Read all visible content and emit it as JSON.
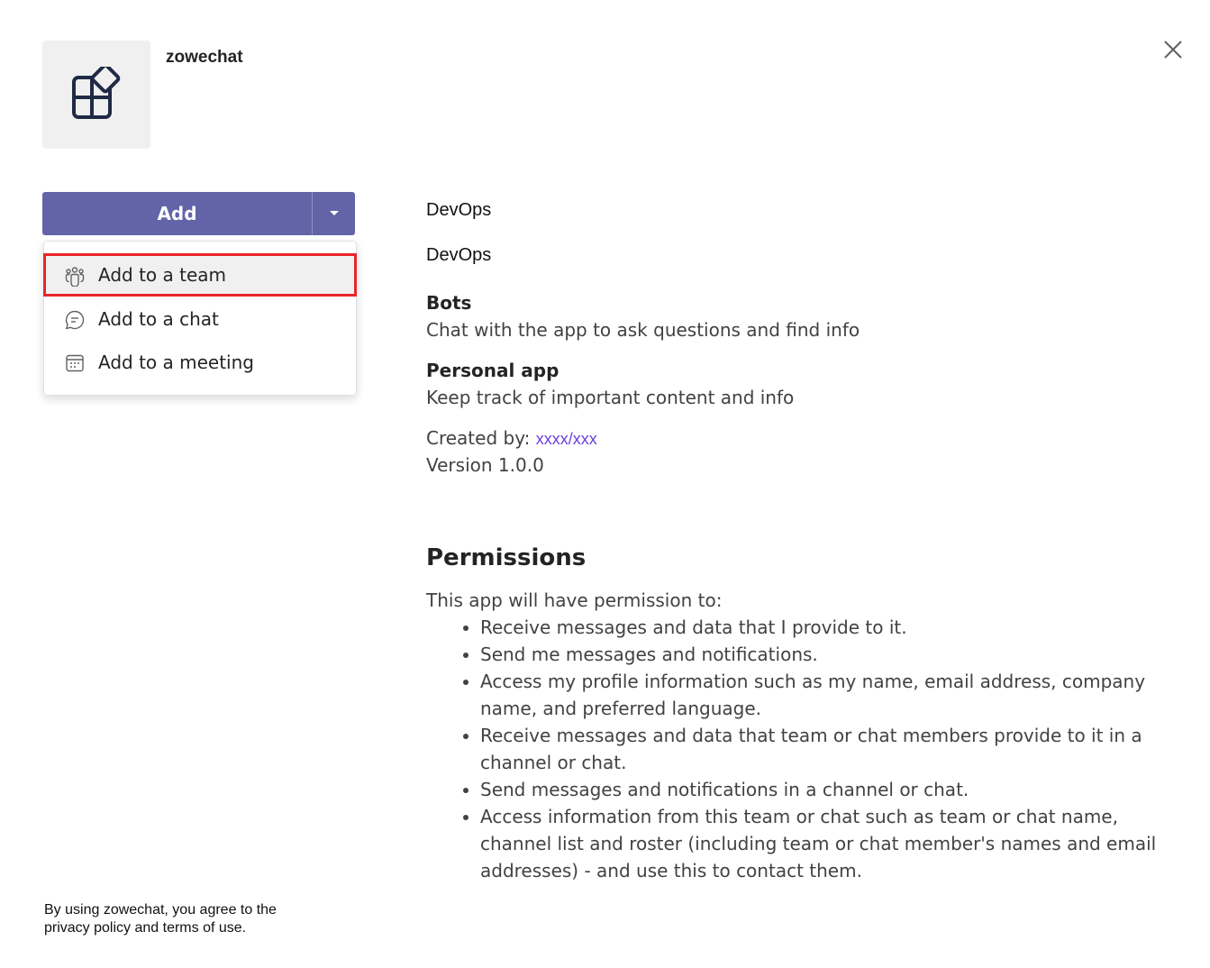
{
  "app": {
    "name": "zowechat",
    "icon": "apps-add-icon"
  },
  "add_button": {
    "label": "Add",
    "caret_icon": "caret-down-icon"
  },
  "menu": {
    "items": [
      {
        "label": "Add to a team",
        "icon": "team-icon"
      },
      {
        "label": "Add to a chat",
        "icon": "chat-icon"
      },
      {
        "label": "Add to a meeting",
        "icon": "calendar-icon"
      }
    ]
  },
  "details": {
    "developer": "DevOps",
    "category": "DevOps",
    "bots_title": "Bots",
    "bots_desc": "Chat with the app to ask questions and find info",
    "personal_title": "Personal app",
    "personal_desc": "Keep track of important content and info",
    "created_by_label": "Created by:",
    "created_by_link": "xxxx/xxx",
    "version": "Version 1.0.0"
  },
  "permissions": {
    "title": "Permissions",
    "intro": "This app will have permission to:",
    "items": [
      "Receive messages and data that I provide to it.",
      "Send me messages and notifications.",
      "Access my profile information such as my name, email address, company name, and preferred language.",
      "Receive messages and data that team or chat members provide to it in a channel or chat.",
      "Send messages and notifications in a channel or chat.",
      "Access information from this team or chat such as team or chat name, channel list and roster (including team or chat member's names and email addresses) - and use this to contact them."
    ]
  },
  "footer": {
    "line1": "By using zowechat, you agree to the",
    "line2": "privacy policy and terms of use."
  },
  "colors": {
    "accent": "#6264a7",
    "highlight_border": "#e8262a",
    "link": "#6b3fe0"
  }
}
